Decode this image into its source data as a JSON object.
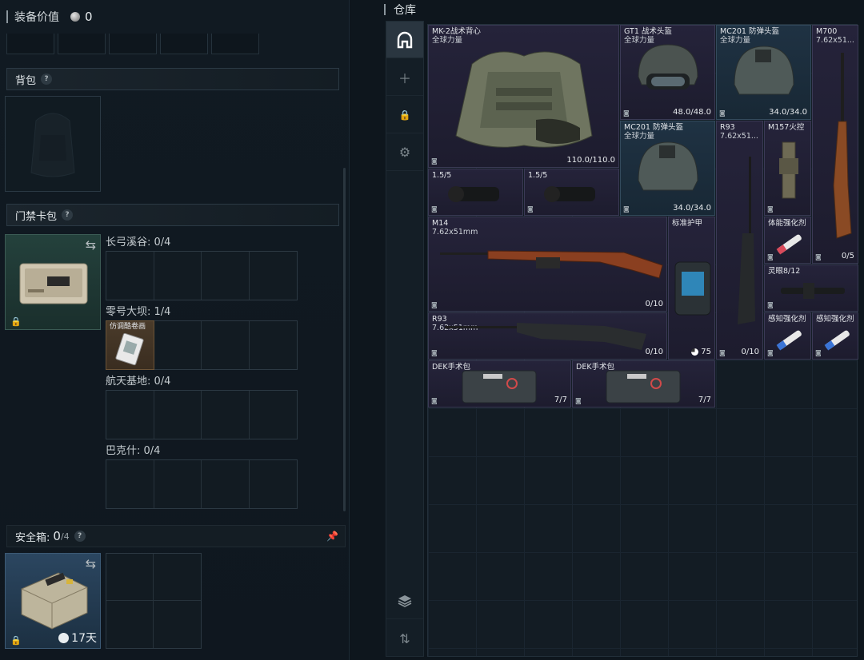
{
  "left": {
    "equip_value_label": "装备价值",
    "equip_value": "0",
    "backpack_label": "背包",
    "cardpack_label": "门禁卡包",
    "card_groups": [
      {
        "label": "长弓溪谷: 0/4"
      },
      {
        "label": "零号大坝: 1/4"
      },
      {
        "label": "航天基地: 0/4"
      },
      {
        "label": "巴克什: 0/4"
      }
    ],
    "card_item_name": "仿调酷卷画",
    "safebox_label": "安全箱:",
    "safebox_count": "0",
    "safebox_cap": "/4",
    "safebox_timer": "17天"
  },
  "right": {
    "title": "仓库",
    "sidebar": [
      "home-icon",
      "plus-icon",
      "lock-icon",
      "gear-icon",
      "layers-icon",
      "sort-icon"
    ],
    "items": [
      {
        "name": "MK-2战术背心",
        "sub": "全球力量",
        "value": "110.0/110.0"
      },
      {
        "name": "GT1 战术头盔",
        "sub": "全球力量",
        "value": "48.0/48.0"
      },
      {
        "name": "MC201 防弹头盔",
        "sub": "全球力量",
        "value": "34.0/34.0"
      },
      {
        "name": "M700",
        "sub": "7.62x51...",
        "value": "0/5"
      },
      {
        "name": "MC201 防弹头盔",
        "sub": "全球力量",
        "value": "34.0/34.0"
      },
      {
        "name": "R93",
        "sub": "7.62x51...",
        "value": "0/10"
      },
      {
        "name": "M157火控",
        "sub": "",
        "value": ""
      },
      {
        "name": "1.5/5",
        "sub": "",
        "value": ""
      },
      {
        "name": "1.5/5",
        "sub": "",
        "value": ""
      },
      {
        "name": "M14",
        "sub": "7.62x51mm",
        "value": "0/10"
      },
      {
        "name": "标准护甲",
        "sub": "",
        "value": "75"
      },
      {
        "name": "体能强化剂",
        "sub": "",
        "value": ""
      },
      {
        "name": "灵眼8/12",
        "sub": "",
        "value": ""
      },
      {
        "name": "R93",
        "sub": "7.62x51mm",
        "value": "0/10"
      },
      {
        "name": "感知强化剂",
        "sub": "",
        "value": ""
      },
      {
        "name": "感知强化剂",
        "sub": "",
        "value": ""
      },
      {
        "name": "DEK手术包",
        "sub": "",
        "value": "7/7"
      },
      {
        "name": "DEK手术包",
        "sub": "",
        "value": "7/7"
      }
    ]
  }
}
